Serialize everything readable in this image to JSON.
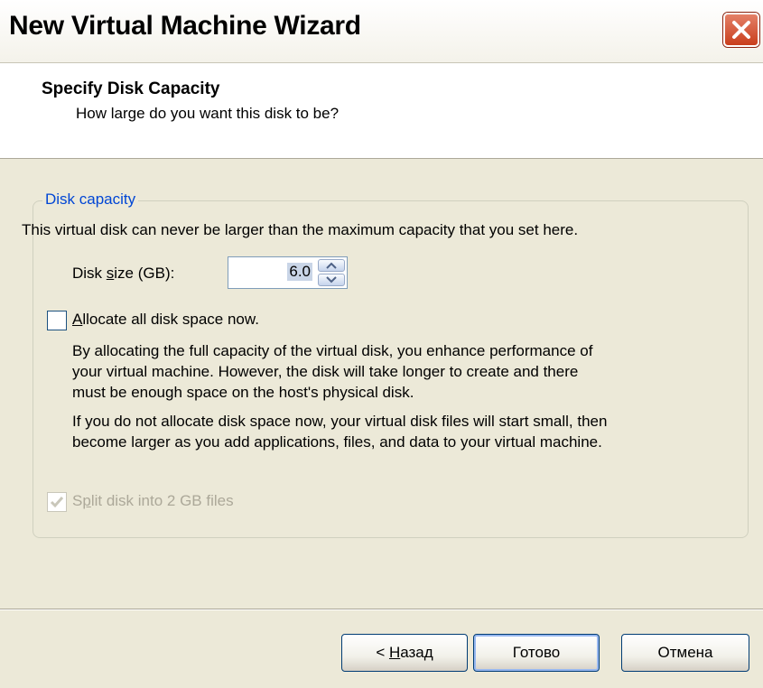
{
  "window": {
    "title": "New Virtual Machine Wizard"
  },
  "header": {
    "title": "Specify Disk Capacity",
    "subtitle": "How large do you want this disk to be?"
  },
  "disk_capacity": {
    "legend": "Disk capacity",
    "description": "This virtual disk can never be larger than the maximum capacity that you set here.",
    "size_label_pre": "Disk ",
    "size_label_accel": "s",
    "size_label_post": "ize (GB):",
    "size_value": "6.0",
    "allocate": {
      "checked": false,
      "label_accel": "A",
      "label_rest": "llocate all disk space now."
    },
    "para1_line1": "By allocating the full capacity of the virtual disk, you enhance performance of",
    "para1_line2": "your virtual machine.  However, the disk will take longer to create and there",
    "para1_line3": "must be enough space on the host's physical disk.",
    "para2_line1": "If you do not allocate disk space now, your virtual disk files will start small, then",
    "para2_line2": "become larger as you add applications, files, and data to your virtual machine.",
    "split": {
      "checked": true,
      "enabled": false,
      "label_pre": "S",
      "label_accel": "p",
      "label_post": "lit disk into 2 GB files"
    }
  },
  "buttons": {
    "back_pre": "< ",
    "back_accel": "Н",
    "back_post": "азад",
    "finish": "Готово",
    "cancel": "Отмена"
  },
  "icons": {
    "close": "close-icon",
    "spin_up": "arrow-up-icon",
    "spin_down": "arrow-down-icon",
    "check": "check-icon"
  },
  "colors": {
    "legend": "#0046d5",
    "close_button": "#c93e1c",
    "disabled_text": "#aca899"
  }
}
